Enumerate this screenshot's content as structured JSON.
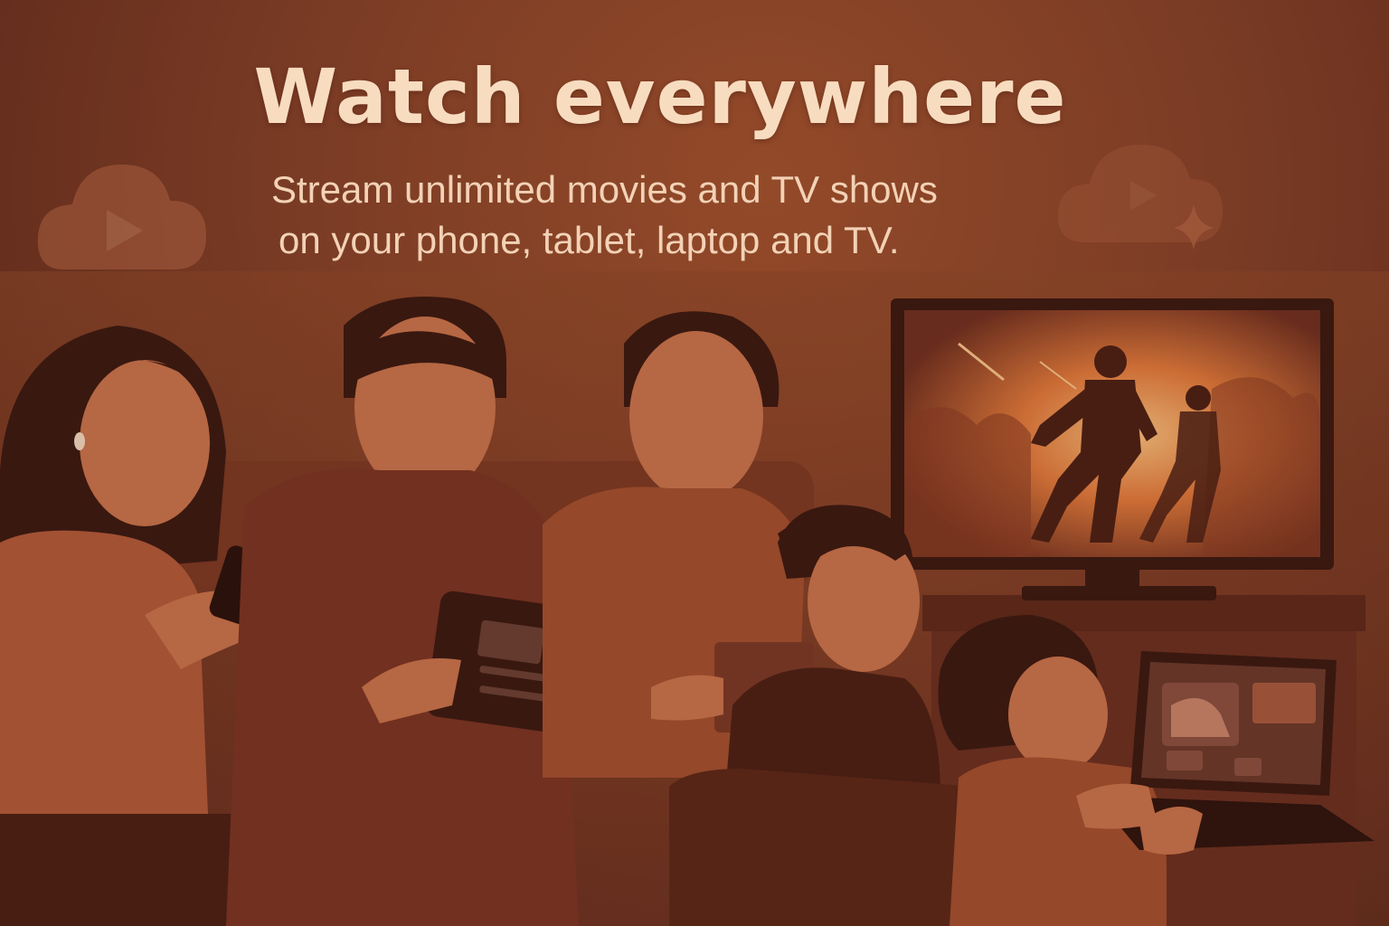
{
  "hero": {
    "title": "Watch everywhere",
    "subtitle_line1": "Stream unlimited movies and TV shows",
    "subtitle_line2": "on your phone, tablet, laptop and TV."
  },
  "icons": {
    "left": "cloud-play-icon",
    "right": "cloud-play-icon",
    "sparkle": "sparkle-icon"
  },
  "colors": {
    "background": "#86432a",
    "title": "#f8dcc0",
    "subtitle": "#f3d2b6",
    "tv_glow": "#f4a15a"
  }
}
